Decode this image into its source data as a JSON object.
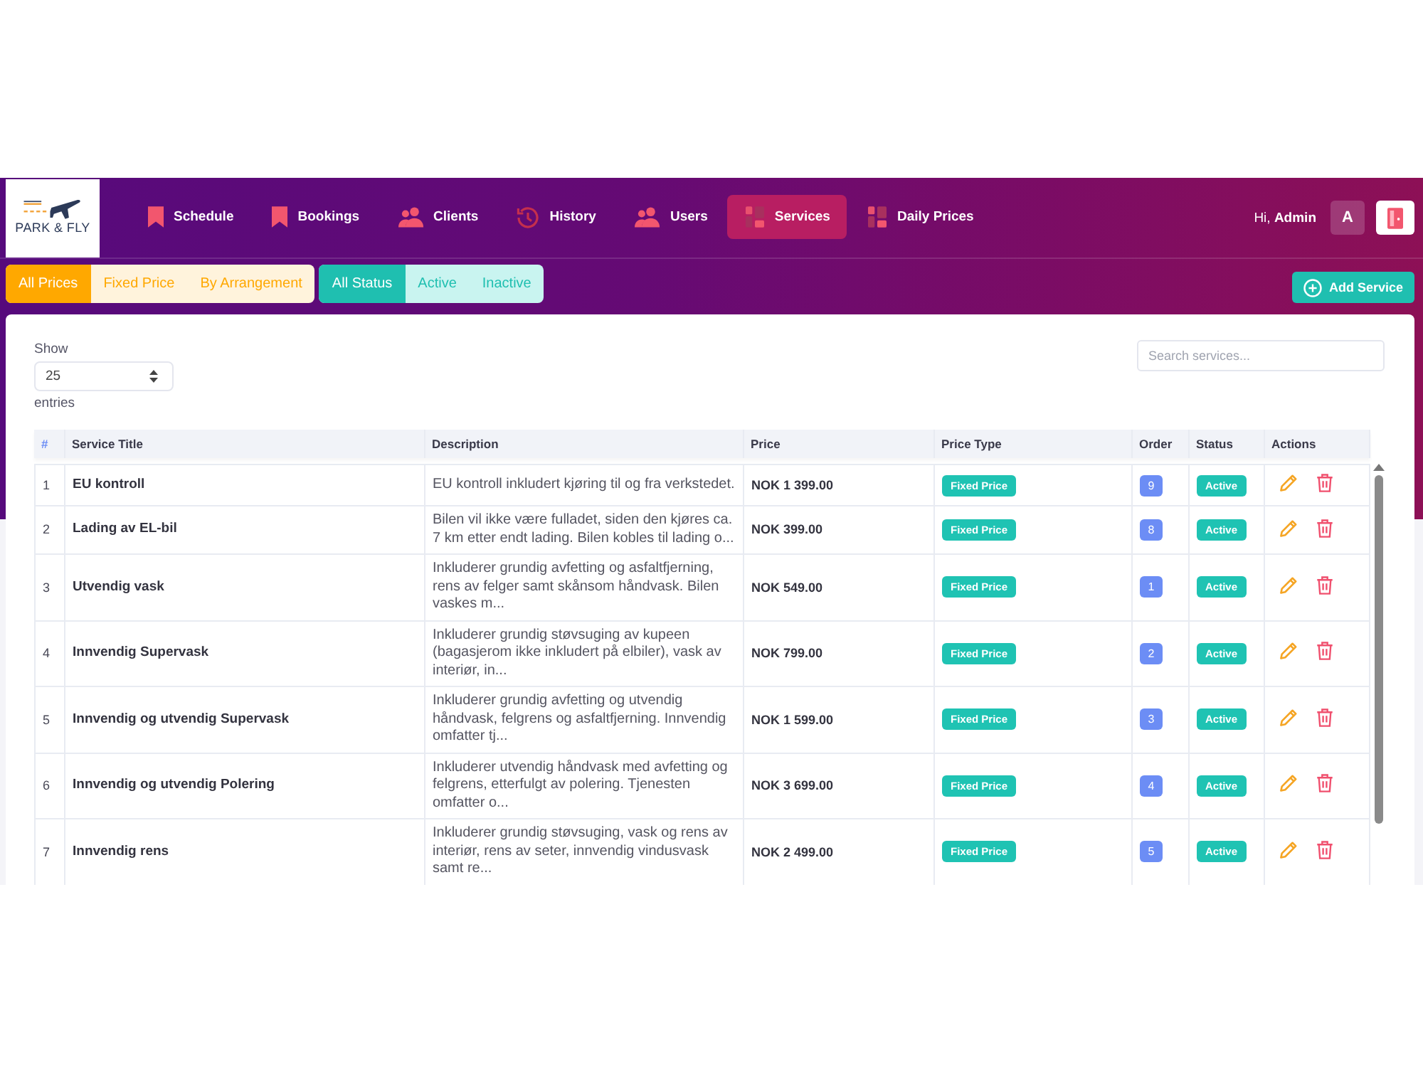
{
  "logo": {
    "text": "PARK & FLY"
  },
  "nav": {
    "items": [
      {
        "label": "Schedule",
        "kind": "bookmark",
        "selected": false
      },
      {
        "label": "Bookings",
        "kind": "bookmark",
        "selected": false
      },
      {
        "label": "Clients",
        "kind": "people",
        "selected": false
      },
      {
        "label": "History",
        "kind": "clock",
        "selected": false
      },
      {
        "label": "Users",
        "kind": "people",
        "selected": false
      },
      {
        "label": "Services",
        "kind": "columns",
        "selected": true
      },
      {
        "label": "Daily Prices",
        "kind": "columns",
        "selected": false
      }
    ]
  },
  "user": {
    "greeting": "Hi, **Admin**",
    "avatar_letter": "A"
  },
  "price_filters": [
    {
      "label": "All Prices",
      "selected": true
    },
    {
      "label": "Fixed Price",
      "selected": false
    },
    {
      "label": "By Arrangement",
      "selected": false
    }
  ],
  "status_filters": [
    {
      "label": "All Status",
      "selected": true
    },
    {
      "label": "Active",
      "selected": false
    },
    {
      "label": "Inactive",
      "selected": false
    }
  ],
  "add_button": {
    "label": "Add Service"
  },
  "length_control": {
    "before": "Show",
    "value": "25",
    "after": "entries"
  },
  "search": {
    "placeholder": "Search services..."
  },
  "table": {
    "columns": [
      "#",
      "Service Title",
      "Description",
      "Price",
      "Price Type",
      "Order",
      "Status",
      "Actions"
    ],
    "rows": [
      {
        "number": "1",
        "title": "EU kontroll",
        "description": "EU kontroll inkludert kjøring til og fra verkstedet.",
        "price": "NOK 1 399.00",
        "price_type": {
          "label": "Fixed Price",
          "kind": "fixed"
        },
        "order": "9",
        "status": {
          "label": "Active",
          "kind": "active"
        }
      },
      {
        "number": "2",
        "title": "Lading av EL-bil",
        "description": "Bilen vil ikke være fulladet, siden den kjøres ca. 7 km etter endt lading. Bilen kobles til lading o...",
        "price": "NOK 399.00",
        "price_type": {
          "label": "Fixed Price",
          "kind": "fixed"
        },
        "order": "8",
        "status": {
          "label": "Active",
          "kind": "active"
        }
      },
      {
        "number": "3",
        "title": "Utvendig vask",
        "description": "Inkluderer grundig avfetting og asfaltfjerning, rens av felger samt skånsom håndvask. Bilen vaskes m...",
        "price": "NOK 549.00",
        "price_type": {
          "label": "Fixed Price",
          "kind": "fixed"
        },
        "order": "1",
        "status": {
          "label": "Active",
          "kind": "active"
        }
      },
      {
        "number": "4",
        "title": "Innvendig Supervask",
        "description": "Inkluderer grundig støvsuging av kupeen (bagasjerom ikke inkludert på elbiler), vask av interiør, in...",
        "price": "NOK 799.00",
        "price_type": {
          "label": "Fixed Price",
          "kind": "fixed"
        },
        "order": "2",
        "status": {
          "label": "Active",
          "kind": "active"
        }
      },
      {
        "number": "5",
        "title": "Innvendig og utvendig Supervask",
        "description": "Inkluderer grundig avfetting og utvendig håndvask, felgrens og asfaltfjerning. Innvendig omfatter tj...",
        "price": "NOK 1 599.00",
        "price_type": {
          "label": "Fixed Price",
          "kind": "fixed"
        },
        "order": "3",
        "status": {
          "label": "Active",
          "kind": "active"
        }
      },
      {
        "number": "6",
        "title": "Innvendig og utvendig Polering",
        "description": "Inkluderer utvendig håndvask med avfetting og felgrens, etterfulgt av polering. Tjenesten omfatter o...",
        "price": "NOK 3 699.00",
        "price_type": {
          "label": "Fixed Price",
          "kind": "fixed"
        },
        "order": "4",
        "status": {
          "label": "Active",
          "kind": "active"
        }
      },
      {
        "number": "7",
        "title": "Innvendig rens",
        "description": "Inkluderer grundig støvsuging, vask og rens av interiør, rens av seter, innvendig vindusvask samt re...",
        "price": "NOK 2 499.00",
        "price_type": {
          "label": "Fixed Price",
          "kind": "fixed"
        },
        "order": "5",
        "status": {
          "label": "Active",
          "kind": "active"
        }
      }
    ]
  }
}
